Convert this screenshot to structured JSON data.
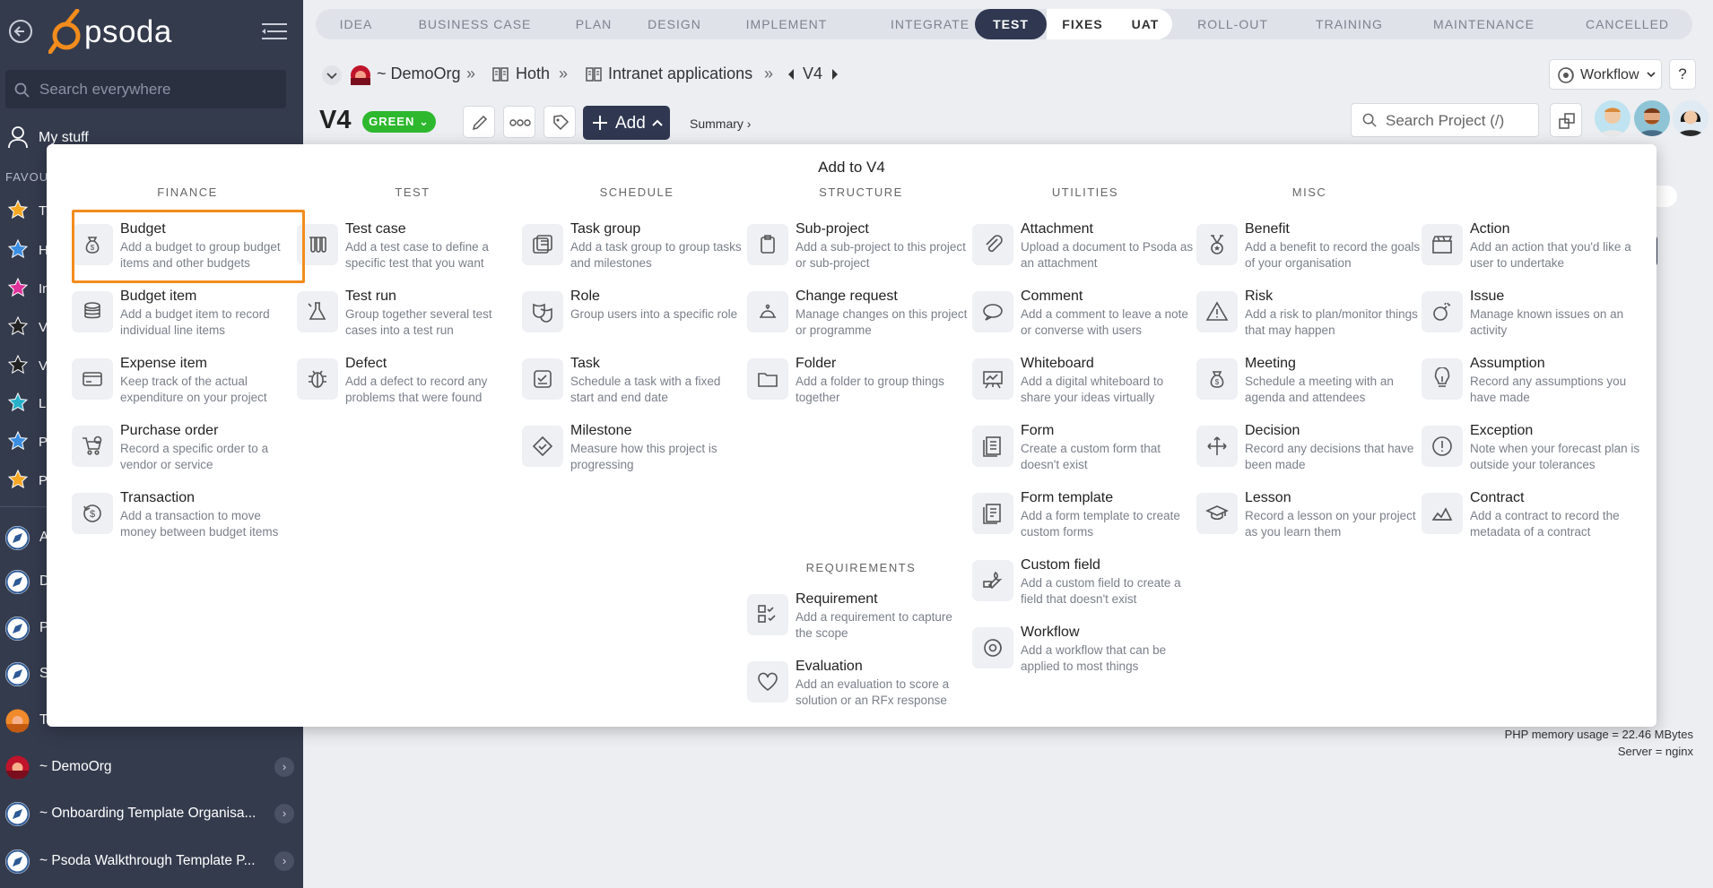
{
  "app": {
    "logo_text": "psoda"
  },
  "sidebar": {
    "search_placeholder": "Search everywhere",
    "my_stuff": "My stuff",
    "favourites_title": "FAVOU",
    "favourites": [
      {
        "label": "T",
        "color": "#f5a623"
      },
      {
        "label": "H",
        "color": "#3a8de0"
      },
      {
        "label": "In",
        "color": "#e0329b"
      },
      {
        "label": "V",
        "color": "#222222"
      },
      {
        "label": "V",
        "color": "#222222"
      },
      {
        "label": "L",
        "color": "#27b1c9"
      },
      {
        "label": "P",
        "color": "#3a8de0"
      },
      {
        "label": "P",
        "color": "#f5a623"
      }
    ],
    "items": [
      {
        "label": "A",
        "icon": "compass-icon"
      },
      {
        "label": "D",
        "icon": "compass-icon"
      },
      {
        "label": "P",
        "icon": "compass-icon"
      },
      {
        "label": "S",
        "icon": "compass-icon"
      },
      {
        "label": "T",
        "icon": "sunset-icon"
      },
      {
        "label": "~ DemoOrg",
        "icon": "sunset-icon"
      },
      {
        "label": "~ Onboarding Template Organisa...",
        "icon": "compass-icon"
      },
      {
        "label": "~ Psoda Walkthrough Template P...",
        "icon": "compass-icon"
      }
    ]
  },
  "phases": [
    "IDEA",
    "BUSINESS CASE",
    "PLAN",
    "DESIGN",
    "IMPLEMENT",
    "INTEGRATE",
    "TEST",
    "FIXES",
    "UAT",
    "ROLL-OUT",
    "TRAINING",
    "MAINTENANCE",
    "CANCELLED"
  ],
  "active_phase": "TEST",
  "breadcrumb": {
    "org": "~ DemoOrg",
    "portfolio": "Hoth",
    "programme": "Intranet applications",
    "project": "V4"
  },
  "header": {
    "title": "V4",
    "status": "GREEN",
    "add_label": "Add",
    "summary_label": "Summary ›",
    "workflow_label": "Workflow",
    "help_label": "?",
    "search_placeholder": "Search Project (/)"
  },
  "footer": {
    "memory": "PHP memory usage = 22.46 MBytes",
    "server": "Server = nginx"
  },
  "menu": {
    "title": "Add to V4",
    "columns": [
      {
        "heading": "FINANCE",
        "items": [
          {
            "name": "Budget",
            "desc": "Add a budget to group budget items and other budgets",
            "icon": "money-bag-icon"
          },
          {
            "name": "Budget item",
            "desc": "Add a budget item to record individual line items",
            "icon": "coins-icon"
          },
          {
            "name": "Expense item",
            "desc": "Keep track of the actual expenditure on your project",
            "icon": "credit-card-icon"
          },
          {
            "name": "Purchase order",
            "desc": "Record a specific order to a vendor or service",
            "icon": "cart-icon"
          },
          {
            "name": "Transaction",
            "desc": "Add a transaction to move money between budget items",
            "icon": "transaction-icon"
          }
        ]
      },
      {
        "heading": "TEST",
        "items": [
          {
            "name": "Test case",
            "desc": "Add a test case to define a specific test that you want",
            "icon": "test-tubes-icon"
          },
          {
            "name": "Test run",
            "desc": "Group together several test cases into a test run",
            "icon": "flask-icon"
          },
          {
            "name": "Defect",
            "desc": "Add a defect to record any problems that were found",
            "icon": "bug-icon"
          }
        ]
      },
      {
        "heading": "SCHEDULE",
        "items": [
          {
            "name": "Task group",
            "desc": "Add a task group to group tasks and milestones",
            "icon": "task-group-icon"
          },
          {
            "name": "Role",
            "desc": "Group users into a specific role",
            "icon": "masks-icon"
          },
          {
            "name": "Task",
            "desc": "Schedule a task with a fixed start and end date",
            "icon": "task-icon"
          },
          {
            "name": "Milestone",
            "desc": "Measure how this project is progressing",
            "icon": "milestone-icon"
          }
        ]
      },
      {
        "heading": "STRUCTURE",
        "items": [
          {
            "name": "Sub-project",
            "desc": "Add a sub-project to this project or sub-project",
            "icon": "clipboard-icon"
          },
          {
            "name": "Change request",
            "desc": "Manage changes on this project or programme",
            "icon": "bell-icon"
          },
          {
            "name": "Folder",
            "desc": "Add a folder to group things together",
            "icon": "folder-icon"
          }
        ]
      },
      {
        "heading": "UTILITIES",
        "items": [
          {
            "name": "Attachment",
            "desc": "Upload a document to Psoda as an attachment",
            "icon": "paperclip-icon"
          },
          {
            "name": "Comment",
            "desc": "Add a comment to leave a note or converse with users",
            "icon": "comment-icon"
          },
          {
            "name": "Whiteboard",
            "desc": "Add a digital whiteboard to share your ideas virtually",
            "icon": "whiteboard-icon"
          },
          {
            "name": "Form",
            "desc": "Create a custom form that doesn't exist",
            "icon": "form-icon"
          },
          {
            "name": "Form template",
            "desc": "Add a form template to create custom forms",
            "icon": "form-template-icon"
          },
          {
            "name": "Custom field",
            "desc": "Add a custom field to create a field that doesn't exist",
            "icon": "wrench-icon"
          },
          {
            "name": "Workflow",
            "desc": "Add a workflow that can be applied to most things",
            "icon": "workflow-icon"
          }
        ]
      },
      {
        "heading": "MISC",
        "items": [
          {
            "name": "Benefit",
            "desc": "Add a benefit to record the goals of your organisation",
            "icon": "medal-icon"
          },
          {
            "name": "Risk",
            "desc": "Add a risk to plan/monitor things that may happen",
            "icon": "warning-icon"
          },
          {
            "name": "Meeting",
            "desc": "Schedule a meeting with an agenda and attendees",
            "icon": "money-bag-icon"
          },
          {
            "name": "Decision",
            "desc": "Record any decisions that have been made",
            "icon": "arrows-icon"
          },
          {
            "name": "Lesson",
            "desc": "Record a lesson on your project as you learn them",
            "icon": "graduation-cap-icon"
          }
        ]
      },
      {
        "heading": "",
        "items": [
          {
            "name": "Action",
            "desc": "Add an action that you'd like a user to undertake",
            "icon": "clapper-icon"
          },
          {
            "name": "Issue",
            "desc": "Manage known issues on an activity",
            "icon": "bomb-icon"
          },
          {
            "name": "Assumption",
            "desc": "Record any assumptions you have made",
            "icon": "lightbulb-icon"
          },
          {
            "name": "Exception",
            "desc": "Note when your forecast plan is outside your tolerances",
            "icon": "exclamation-icon"
          },
          {
            "name": "Contract",
            "desc": "Add a contract to record the metadata of a contract",
            "icon": "contract-icon"
          }
        ]
      }
    ],
    "requirements": {
      "heading": "REQUIREMENTS",
      "items": [
        {
          "name": "Requirement",
          "desc": "Add a requirement to capture the scope",
          "icon": "checklist-icon"
        },
        {
          "name": "Evaluation",
          "desc": "Add an evaluation to score a solution or an RFx response",
          "icon": "heart-icon"
        }
      ]
    }
  }
}
